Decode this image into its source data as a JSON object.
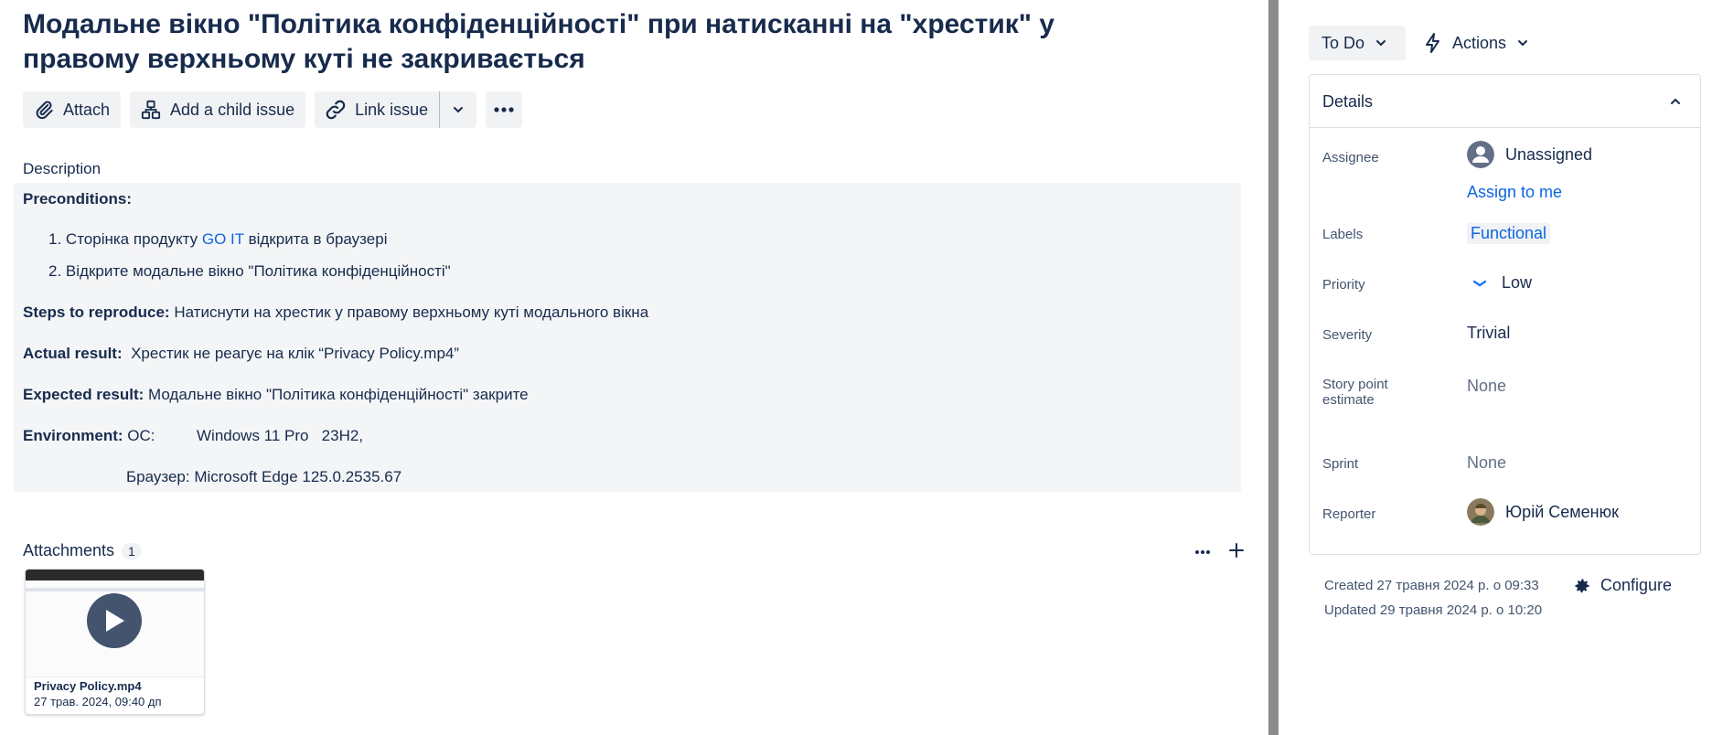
{
  "issue": {
    "title": "Модальне вікно \"Політика конфіденційності\" при натисканні на \"хрестик\" у правому верхньому куті не закривається"
  },
  "toolbar": {
    "attach_label": "Attach",
    "child_issue_label": "Add a child issue",
    "link_issue_label": "Link issue"
  },
  "description": {
    "label": "Description",
    "preconditions_title": "Preconditions:",
    "pre1_num": "1.",
    "pre1_before": "Сторінка продукту",
    "pre1_link": "GO IT",
    "pre1_after": "відкрита в браузері",
    "pre2_num": "2.",
    "pre2_text": "Відкрите модальне вікно \"Політика конфіденційності\"",
    "steps_label": "Steps to reproduce:",
    "steps_text": "Натиснути на хрестик у правому верхньому куті модального вікна",
    "actual_label": "Actual result:",
    "actual_text": "Хрестик не реагує на клік “Privacy Policy.mp4”",
    "expected_label": "Expected result:",
    "expected_text": "Модальне вікно \"Політика конфіденційності\" закрите",
    "env_label": "Environment:",
    "env_os_label": "ОС:",
    "env_os_value": "Windows 11 Pro   23H2,",
    "env_browser": "Браузер: Microsoft Edge 125.0.2535.67"
  },
  "attachments": {
    "label": "Attachments",
    "count": "1",
    "file_name": "Privacy Policy.mp4",
    "file_date": "27 трав. 2024, 09:40 дп"
  },
  "sidebar": {
    "status_label": "To Do",
    "actions_label": "Actions",
    "details_title": "Details",
    "fields": {
      "assignee_label": "Assignee",
      "assignee_value": "Unassigned",
      "assign_to_me": "Assign to me",
      "labels_label": "Labels",
      "labels_value": "Functional",
      "priority_label": "Priority",
      "priority_value": "Low",
      "severity_label": "Severity",
      "severity_value": "Trivial",
      "story_point_label_1": "Story point",
      "story_point_label_2": "estimate",
      "story_point_value": "None",
      "sprint_label": "Sprint",
      "sprint_value": "None",
      "reporter_label": "Reporter",
      "reporter_value": "Юрій Семенюк"
    },
    "created": "Created 27 травня 2024 р. о 09:33",
    "updated": "Updated 29 травня 2024 р. о 10:20",
    "configure_label": "Configure"
  },
  "icons": {
    "attach": "paperclip-icon",
    "child": "hierarchy-icon",
    "link": "link-icon",
    "more": "more-horizontal-icon",
    "play": "play-icon",
    "actions": "lightning-icon",
    "priority": "priority-low-icon",
    "configure": "gear-icon"
  },
  "colors": {
    "text": "#172b4d",
    "link": "#0c66e4",
    "button_bg": "#f1f2f4",
    "description_bg": "#f4f5f7",
    "divider": "#8c8c8c",
    "priority_low": "#1d7afc"
  }
}
